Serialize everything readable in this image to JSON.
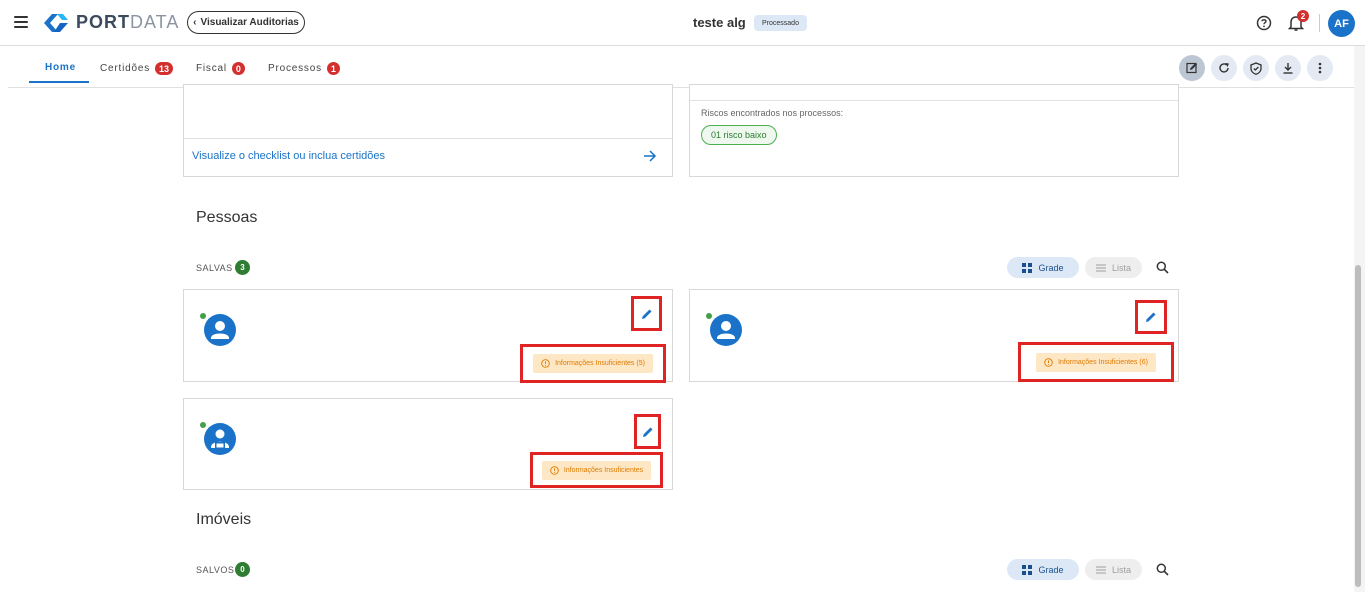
{
  "header": {
    "brand_port": "PORT",
    "brand_data": "DATA",
    "back_label": "Visualizar Auditorias",
    "doc_title": "teste alg",
    "status": "Processado",
    "notification_count": "2",
    "avatar_initials": "AF"
  },
  "tabs": [
    {
      "label": "Home",
      "count": null
    },
    {
      "label": "Certidões",
      "count": "13"
    },
    {
      "label": "Fiscal",
      "count": "0"
    },
    {
      "label": "Processos",
      "count": "1"
    }
  ],
  "actions": [
    "edit-icon",
    "refresh-icon",
    "shield-icon",
    "download-icon",
    "more-vert-icon"
  ],
  "certidoes_card": {
    "link_text": "Visualize o checklist ou inclua certidões"
  },
  "processos_card": {
    "risk_label": "Riscos encontrados nos processos:",
    "risk_pill": "01 risco baixo"
  },
  "pessoas": {
    "title": "Pessoas",
    "saved_label": "SALVAS",
    "saved_count": "3",
    "view_grid": "Grade",
    "view_list": "Lista",
    "cards": [
      {
        "warning": "Informações Insuficientes (5)",
        "type": "person-icon"
      },
      {
        "warning": "Informações Insuficientes (6)",
        "type": "person-icon"
      },
      {
        "warning": "Informações Insuficientes",
        "type": "business-person-icon"
      }
    ]
  },
  "imoveis": {
    "title": "Imóveis",
    "saved_label": "SALVOS",
    "saved_count": "0",
    "view_grid": "Grade",
    "view_list": "Lista"
  },
  "colors": {
    "accent": "#1a73c8",
    "badge_red": "#d32f2f",
    "success_green": "#2e7d32",
    "warning_orange": "#e07b00",
    "highlight_red": "#e02424"
  }
}
